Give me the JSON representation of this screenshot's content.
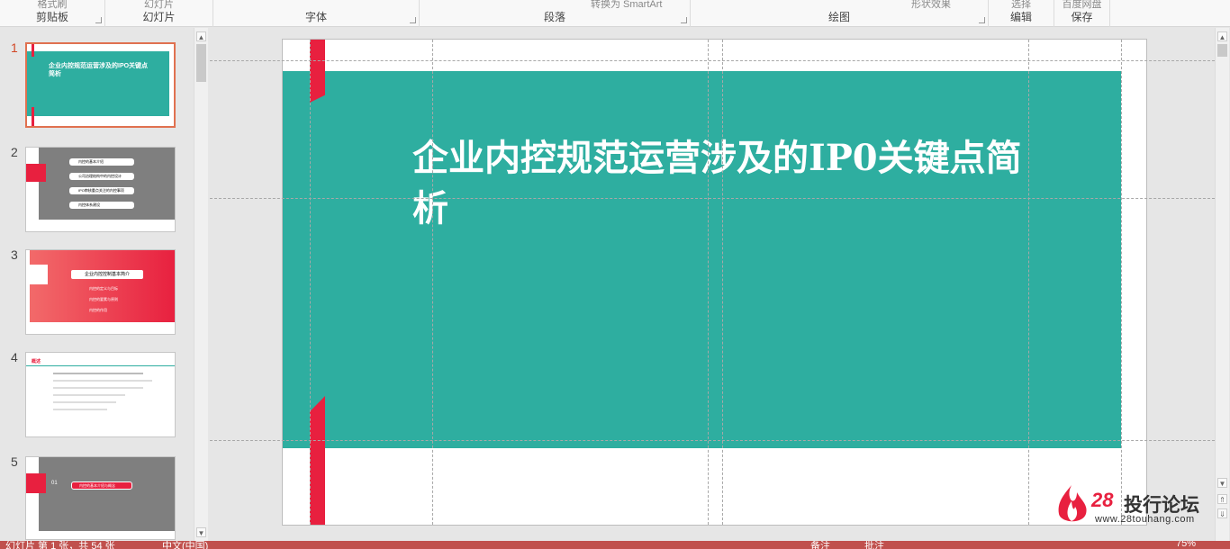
{
  "ribbon": {
    "groups": [
      {
        "name": "clipboard",
        "label": "剪贴板",
        "cut": "格式刷"
      },
      {
        "name": "slides",
        "label": "幻灯片",
        "cut": "幻灯片"
      },
      {
        "name": "font",
        "label": "字体",
        "cut": ""
      },
      {
        "name": "paragraph",
        "label": "段落",
        "cut": "转换为 SmartArt"
      },
      {
        "name": "drawing",
        "label": "绘图",
        "cut": "形状效果"
      },
      {
        "name": "editing",
        "label": "编辑",
        "cut": "选择"
      },
      {
        "name": "save",
        "label": "保存",
        "cut": "百度网盘"
      }
    ]
  },
  "thumbnails": [
    {
      "num": "1",
      "active": true,
      "title": "企业内控规范运营涉及的IPO关键点简析"
    },
    {
      "num": "2",
      "active": false,
      "items": [
        "内控的基本介绍",
        "公司治理结构中的内控设计",
        "IPO审核重点关注的内控事项",
        "内控体系建设"
      ]
    },
    {
      "num": "3",
      "active": false,
      "heading": "企业内控控制基本简介",
      "items": [
        "内控的定义与目标",
        "内控的要素与原则",
        "内控的作用"
      ]
    },
    {
      "num": "4",
      "active": false,
      "heading": "概述"
    },
    {
      "num": "5",
      "active": false,
      "num_label": "01",
      "pill": "内控的基本介绍与概念"
    }
  ],
  "slide": {
    "title": "企业内控规范运营涉及的IP0关键点简析",
    "colors": {
      "teal": "#2eaea0",
      "accent": "#e8203f"
    }
  },
  "watermark": {
    "num": "28",
    "text": "投行论坛",
    "url": "www.28touhang.com"
  },
  "statusbar": {
    "slide_info": "幻灯片 第 1 张，共 54 张",
    "language": "中文(中国)",
    "notes": "备注",
    "comments": "批注",
    "zoom": "75%"
  }
}
